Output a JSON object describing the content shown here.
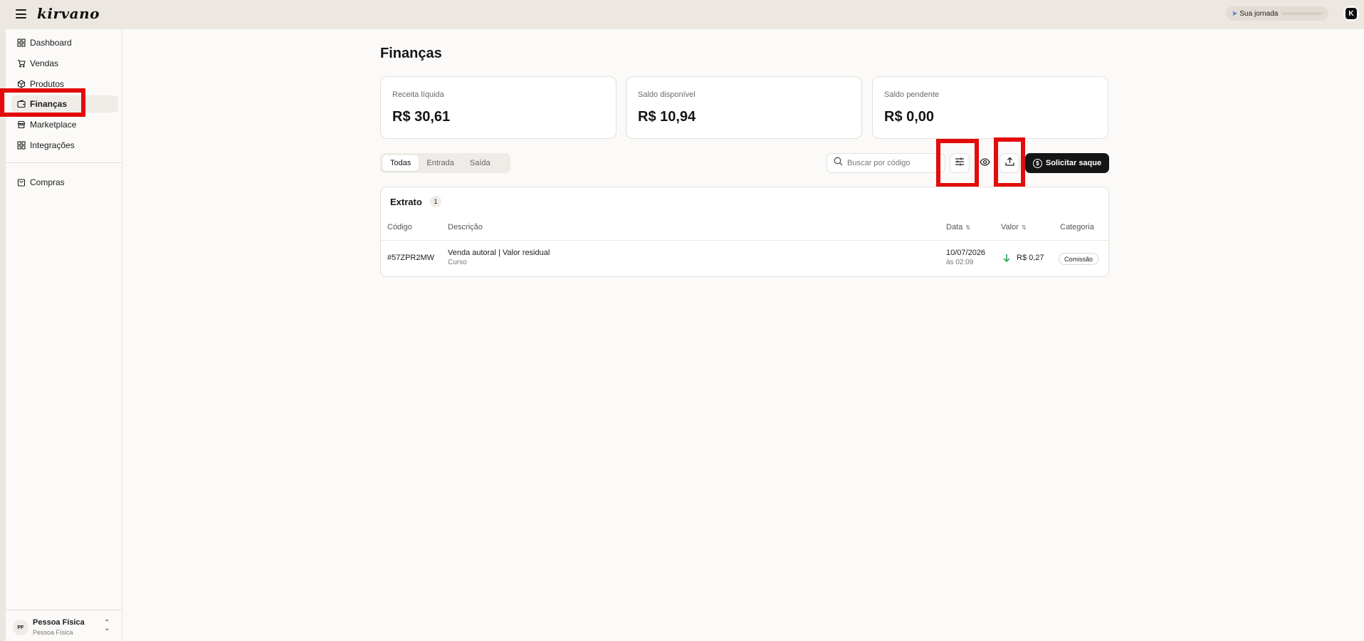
{
  "header": {
    "logo": "kirvano",
    "journey_label": "Sua jornada",
    "journey_progress": 0,
    "avatar_letter": "K"
  },
  "sidebar": {
    "items": [
      {
        "label": "Dashboard",
        "icon": "grid-icon"
      },
      {
        "label": "Vendas",
        "icon": "cart-icon"
      },
      {
        "label": "Produtos",
        "icon": "box-icon"
      },
      {
        "label": "Finanças",
        "icon": "wallet-icon"
      },
      {
        "label": "Marketplace",
        "icon": "store-icon"
      },
      {
        "label": "Integrações",
        "icon": "apps-icon"
      },
      {
        "label": "Compras",
        "icon": "bag-icon"
      }
    ],
    "active_item": "Finanças",
    "profile": {
      "initials": "PF",
      "name": "Pessoa Física",
      "type": "Pessoa Física"
    }
  },
  "main": {
    "title": "Finanças",
    "cards": [
      {
        "label": "Receita líquida",
        "value": "R$ 30,61"
      },
      {
        "label": "Saldo disponível",
        "value": "R$ 10,94"
      },
      {
        "label": "Saldo pendente",
        "value": "R$ 0,00"
      }
    ],
    "tabs": [
      {
        "label": "Todas",
        "active": true
      },
      {
        "label": "Entrada",
        "active": false
      },
      {
        "label": "Saída",
        "active": false
      }
    ],
    "search": {
      "placeholder": "Buscar por código",
      "value": ""
    },
    "withdraw_label": "Solicitar saque",
    "statement": {
      "title": "Extrato",
      "count": "1",
      "columns": [
        "Código",
        "Descrição",
        "Data",
        "Valor",
        "Categoria"
      ],
      "rows": [
        {
          "code": "#57ZPR2MW",
          "description": "Venda autoral | Valor residual",
          "description_sub": "Curso",
          "date": "10/07/2026",
          "time": "às 02:09",
          "value": "R$ 0,27",
          "direction": "entrada",
          "category": "Comissão"
        }
      ]
    }
  },
  "colors": {
    "topbar": "#ece7e1",
    "background": "#fbfaf8",
    "primary_button": "#151515",
    "highlight": "#e30b0b",
    "positive_arrow": "#1aa34a"
  }
}
